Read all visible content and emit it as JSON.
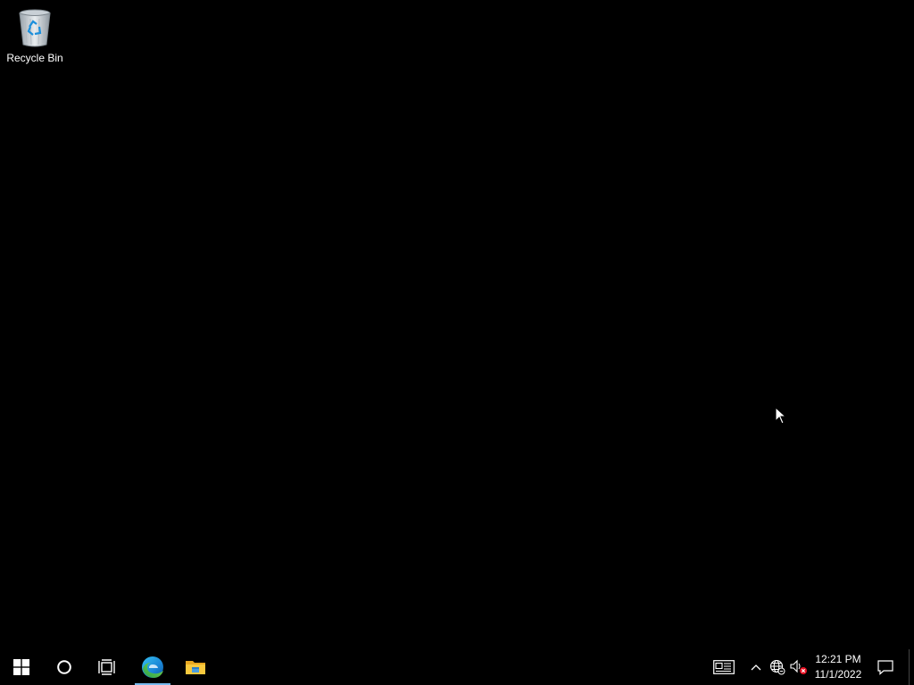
{
  "desktop": {
    "icons": [
      {
        "label": "Recycle Bin",
        "icon": "recycle-bin-icon"
      }
    ],
    "background": "#000000"
  },
  "taskbar": {
    "background": "#000000",
    "start": {
      "icon": "windows-logo-icon"
    },
    "search": {
      "icon": "cortana-circle-icon"
    },
    "task_view": {
      "icon": "task-view-icon"
    },
    "pinned": [
      {
        "app": "edge",
        "icon": "edge-icon",
        "active": true
      },
      {
        "app": "file-explorer",
        "icon": "folder-icon",
        "active": false
      }
    ],
    "active_indicator_color": "#76b9ed"
  },
  "tray": {
    "news": {
      "icon": "news-icon"
    },
    "hidden_icons": {
      "icon": "chevron-up-icon"
    },
    "network": {
      "icon": "globe-icon"
    },
    "volume": {
      "icon": "speaker-muted-icon",
      "status_color": "#e81123"
    },
    "clock": {
      "time": "12:21 PM",
      "date": "11/1/2022"
    },
    "notifications": {
      "icon": "action-center-icon"
    }
  }
}
